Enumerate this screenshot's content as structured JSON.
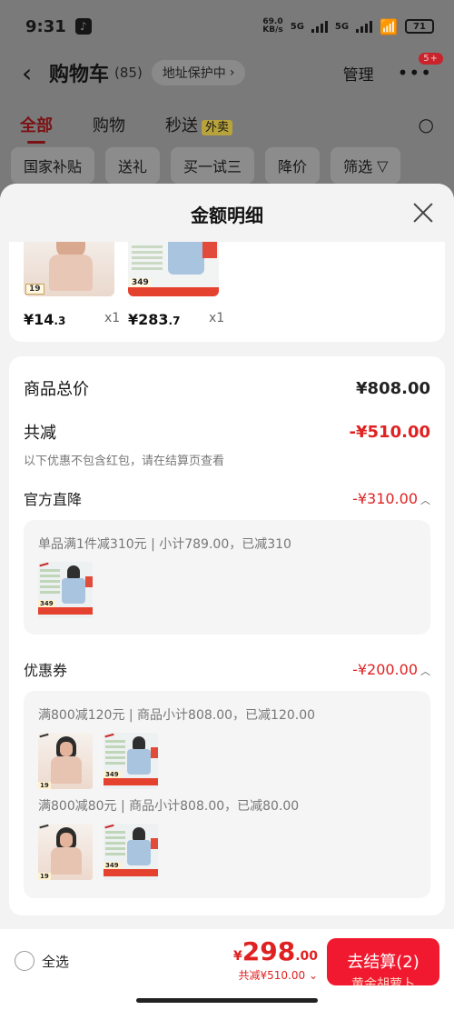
{
  "status_bar": {
    "time": "9:31",
    "net_speed": "69.0",
    "net_unit": "KB/s",
    "signal1": "5G",
    "signal2": "5G",
    "battery": "71"
  },
  "header": {
    "back_icon": "back-arrow-icon",
    "title": "购物车",
    "count": "(85)",
    "address_protect": "地址保护中",
    "manage": "管理",
    "more_badge": "5+"
  },
  "tabs": [
    {
      "label": "全部"
    },
    {
      "label": "购物"
    },
    {
      "label": "秒送",
      "badge": "外卖"
    }
  ],
  "chips": [
    "国家补贴",
    "送礼",
    "买一试三",
    "降价",
    "筛选"
  ],
  "sheet": {
    "title": "金额明细",
    "items": [
      {
        "price_main": "¥14",
        "price_dec": ".3",
        "qty": "x1",
        "thumb_price": "19"
      },
      {
        "price_main": "¥283",
        "price_dec": ".7",
        "qty": "x1",
        "thumb_price": "349"
      }
    ],
    "goods_total_label": "商品总价",
    "goods_total": "¥808.00",
    "discount_label": "共减",
    "discount_total": "-¥510.00",
    "discount_note": "以下优惠不包含红包，请在结算页查看",
    "official": {
      "label": "官方直降",
      "value": "-¥310.00",
      "detail": "单品满1件减310元 | 小计789.00，已减310"
    },
    "coupon": {
      "label": "优惠券",
      "value": "-¥200.00",
      "detail1": "满800减120元 | 商品小计808.00，已减120.00",
      "detail2": "满800减80元 | 商品小计808.00，已减80.00"
    },
    "mini_prices": {
      "bra": "19",
      "jacket": "349"
    }
  },
  "bottom": {
    "select_all": "全选",
    "currency": "¥",
    "total_int": "298",
    "total_dec": ".00",
    "saved": "共减¥510.00",
    "checkout": "去结算(2)",
    "checkout_sub": "黄金胡萝卜"
  }
}
